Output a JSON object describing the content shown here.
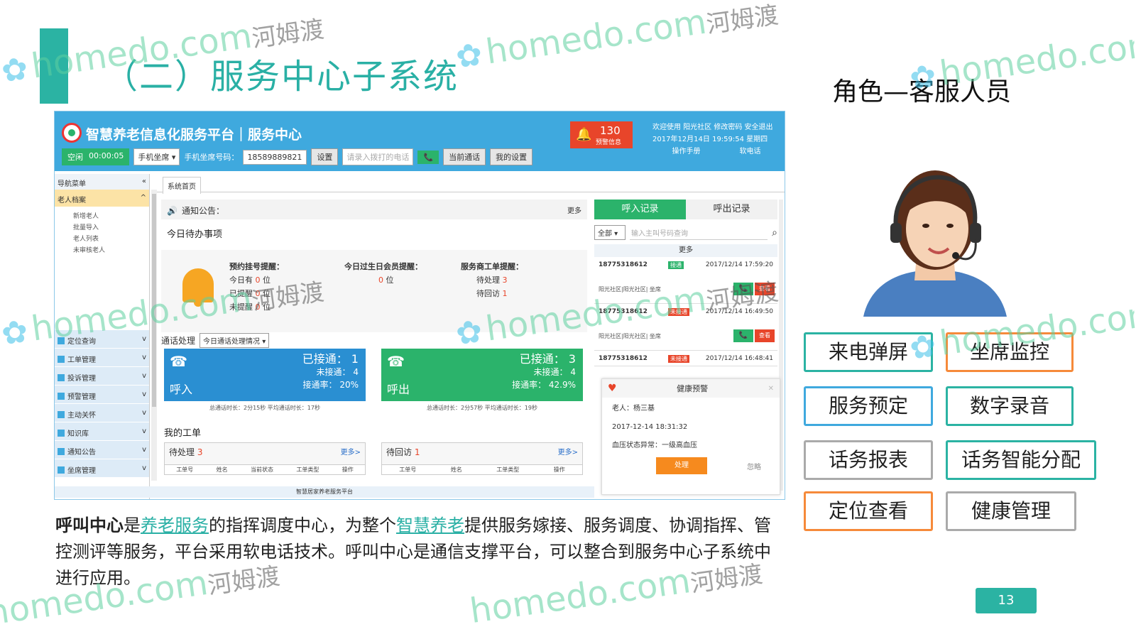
{
  "slide": {
    "title": "（二）服务中心子系统",
    "role_title": "角色—客服人员",
    "page_number": "13",
    "accent_color": "#2bb3a3",
    "paragraph": {
      "p1": "呼叫中心",
      "p2": "是",
      "link1": "养老服务",
      "p3": "的指挥调度中心，为整个",
      "link2": "智慧养老",
      "p4": "提供服务嫁接、服务调度、协调指挥、管控测评等服务，平台采用软电话技术。呼叫中心是通信支撑平台，可以整合到服务中心子系统中进行应用。"
    },
    "roles": [
      {
        "label": "来电弹屏",
        "color": "#2bb3a3"
      },
      {
        "label": "坐席监控",
        "color": "#f68a3a"
      },
      {
        "label": "服务预定",
        "color": "#3fa9de"
      },
      {
        "label": "数字录音",
        "color": "#2bb3a3"
      },
      {
        "label": "话务报表",
        "color": "#aaaaaa"
      },
      {
        "label": "话务智能分配",
        "color": "#2bb3a3"
      },
      {
        "label": "定位查看",
        "color": "#f68a3a"
      },
      {
        "label": "健康管理",
        "color": "#aaaaaa"
      }
    ]
  },
  "app": {
    "title": "智慧养老信息化服务平台｜服务中心",
    "header_color": "#3fa9de",
    "alert": {
      "count": "130",
      "label": "预警信息"
    },
    "header_links": {
      "line1": "欢迎使用 阳光社区   修改密码   安全退出",
      "line2": "2017年12月14日 19:59:54 星期四",
      "manual": "操作手册",
      "softphone": "软电话"
    },
    "toolbar": {
      "status": "空闲",
      "timer": "00:00:05",
      "seat_select": "手机坐席 ▾",
      "seat_label": "手机坐席号码：",
      "seat_number": "18589889821",
      "set_btn": "设置",
      "dial_placeholder": "请录入拨打的电话",
      "call_icon": "phone-icon",
      "current_call": "当前通话",
      "my_settings": "我的设置"
    },
    "nav": {
      "header": "导航菜单",
      "collapse": "«",
      "active_group": "老人档案",
      "sub_items": [
        "新增老人",
        "批量导入",
        "老人列表",
        "未审核老人"
      ],
      "items": [
        "定位查询",
        "工单管理",
        "投诉管理",
        "预警管理",
        "主动关怀",
        "知识库",
        "通知公告",
        "坐席管理"
      ]
    },
    "tab": "系统首页",
    "notice": {
      "label": "通知公告：",
      "more": "更多"
    },
    "todo_title": "今日待办事项",
    "reminders": {
      "col1": {
        "title": "预约挂号提醒：",
        "l1a": "今日有 ",
        "l1b": "0",
        "l1c": " 位",
        "l2a": "已提醒 ",
        "l2b": "0",
        "l2c": " 位",
        "l3a": "未提醒 ",
        "l3b": "0",
        "l3c": " 位"
      },
      "col2": {
        "title": "今日过生日会员提醒：",
        "l1b": "0",
        "l1c": " 位"
      },
      "col3": {
        "title": "服务商工单提醒：",
        "l1a": "待处理 ",
        "l1b": "3",
        "l2a": "待回访 ",
        "l2b": "1"
      }
    },
    "call_handle": {
      "label": "通话处理",
      "select": "今日通话处理情况 ▾"
    },
    "cards": {
      "in": {
        "kind": "呼入",
        "answered": "已接通：  1",
        "unanswered": "未接通：  4",
        "rate": "接通率：  20%",
        "sub": "总通话时长：2分15秒     平均通话时长：17秒"
      },
      "out": {
        "kind": "呼出",
        "answered": "已接通：  3",
        "unanswered": "未接通：  4",
        "rate": "接通率：  42.9%",
        "sub": "总通话时长：2分57秒     平均通话时长：19秒"
      }
    },
    "my_orders": "我的工单",
    "orders": {
      "pending": {
        "label": "待处理",
        "count": "3",
        "more": "更多>",
        "cols": [
          "工单号",
          "姓名",
          "当前状态",
          "工单类型",
          "操作"
        ]
      },
      "revisit": {
        "label": "待回访",
        "count": "1",
        "more": "更多>",
        "cols": [
          "工单号",
          "姓名",
          "工单类型",
          "操作"
        ]
      }
    },
    "call_panel": {
      "tab_in": "呼入记录",
      "tab_out": "呼出记录",
      "filter": "全部 ▾",
      "search_placeholder": "输入主叫号码查询",
      "more": "更多",
      "records": [
        {
          "number": "18775318612",
          "tag": "接通",
          "time": "2017/12/14  17:59:20",
          "addr": "阳光社区|阳光社区|  坐席",
          "call": "📞",
          "view": "查看"
        },
        {
          "number": "18775318612",
          "tag": "未接通",
          "time": "2017/12/14  16:49:50",
          "addr": "阳光社区|阳光社区|  坐席",
          "call": "📞",
          "view": "查看"
        },
        {
          "number": "18775318612",
          "tag": "未接通",
          "time": "2017/12/14  16:48:41"
        }
      ]
    },
    "health": {
      "title": "健康预警",
      "elder": "老人：杨三基",
      "datetime": "2017-12-14  18:31:32",
      "status": "血压状态异常：一级高血压",
      "handle": "处理",
      "ignore": "忽略"
    },
    "footer": "智慧居家养老服务平台"
  },
  "watermark": {
    "text": "homedo.com",
    "cn": "河姆渡"
  }
}
